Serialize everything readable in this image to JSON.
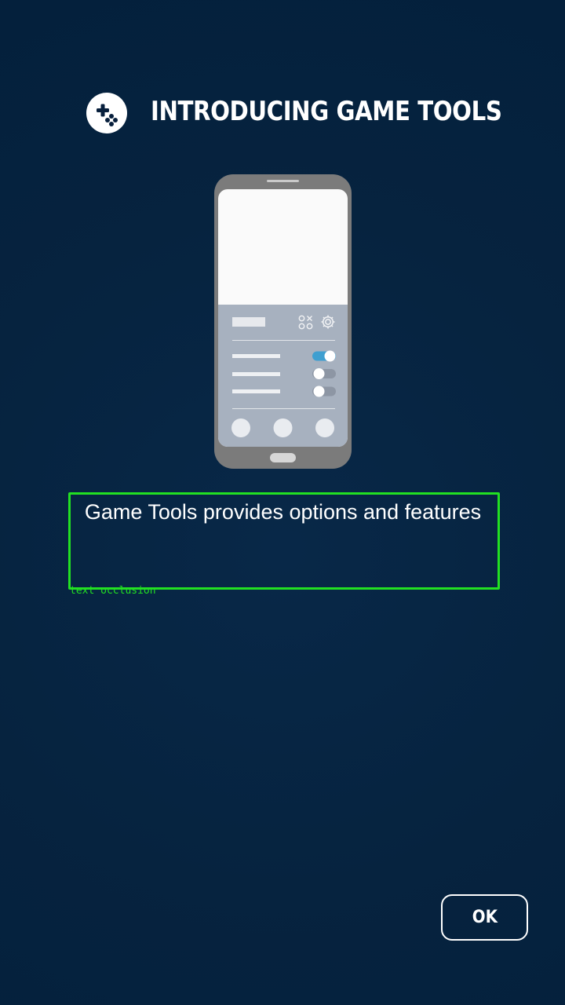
{
  "header": {
    "icon": "game-controller-icon",
    "title": "INTRODUCING GAME TOOLS"
  },
  "illustration": {
    "icon": "phone-illustration",
    "panel_icons": [
      "game-mode-icon",
      "settings-gear-icon"
    ],
    "toggles": [
      {
        "state": "on"
      },
      {
        "state": "off"
      },
      {
        "state": "off"
      }
    ]
  },
  "description": {
    "text": "Game Tools provides options and features"
  },
  "overlay": {
    "label": "text occlusion",
    "color": "#22e022"
  },
  "actions": {
    "ok_label": "OK"
  },
  "colors": {
    "background": "#052240",
    "panel": "#a7b1bf",
    "toggle_on": "#3f9fd0"
  }
}
